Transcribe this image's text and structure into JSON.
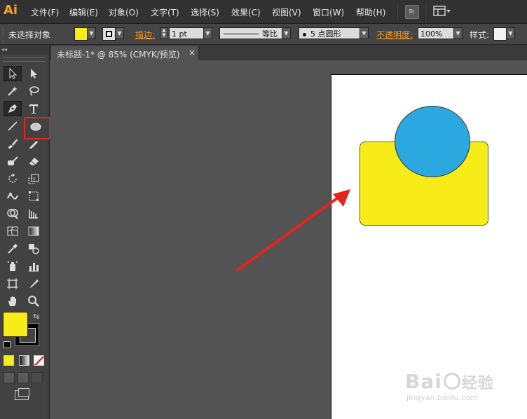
{
  "app": {
    "logo": "Ai"
  },
  "menu": {
    "items": [
      "文件(F)",
      "编辑(E)",
      "对象(O)",
      "文字(T)",
      "选择(S)",
      "效果(C)",
      "视图(V)",
      "窗口(W)",
      "帮助(H)"
    ],
    "bridge_label": "Br"
  },
  "control_bar": {
    "selection_status": "未选择对象",
    "stroke_label": "描边:",
    "stroke_weight": "1 pt",
    "stroke_profile": "等比",
    "brush": "5 点圆形",
    "opacity_label": "不透明度:",
    "opacity_value": "100%",
    "style_label": "样式:"
  },
  "document_tab": {
    "title": "未标题-1* @ 85% (CMYK/预览)",
    "close": "×"
  },
  "colors": {
    "fill": "#f7eb18",
    "stroke": "#000000",
    "shape_rect": "#f7eb18",
    "shape_circle": "#2ca8e0",
    "annotation": "#e8221f"
  },
  "watermark": {
    "line1": "Bai",
    "line2": "经验",
    "url": "jingyan.baidu.com"
  }
}
